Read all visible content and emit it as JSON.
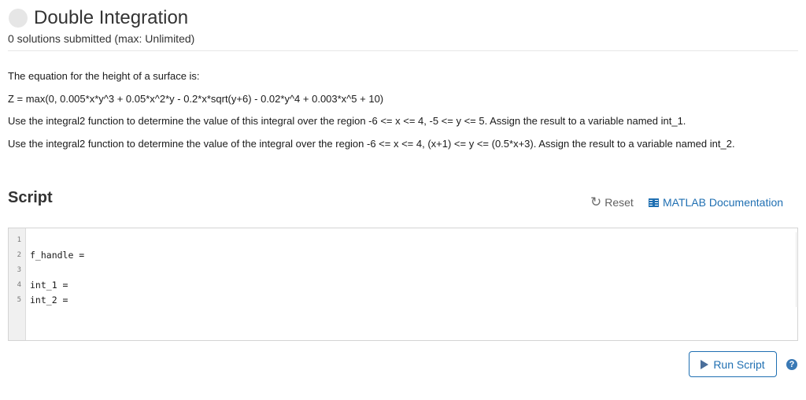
{
  "header": {
    "title": "Double Integration",
    "subtitle": "0 solutions submitted (max: Unlimited)"
  },
  "description": {
    "paragraphs": [
      "The equation for the height of a surface is:",
      "Z = max(0, 0.005*x*y^3 + 0.05*x^2*y - 0.2*x*sqrt(y+6) - 0.02*y^4 + 0.003*x^5 + 10)",
      "Use the integral2 function to determine the value of this integral over the region -6 <= x <= 4, -5 <= y <= 5. Assign the result to a variable named int_1.",
      "Use the integral2 function to determine the value of the integral over the region  -6 <= x <= 4, (x+1) <= y <= (0.5*x+3). Assign the result to a variable named int_2."
    ]
  },
  "script": {
    "heading": "Script",
    "reset_label": "Reset",
    "doc_label": "MATLAB Documentation",
    "lines": [
      {
        "num": "1",
        "code": ""
      },
      {
        "num": "2",
        "code": "f_handle ="
      },
      {
        "num": "3",
        "code": ""
      },
      {
        "num": "4",
        "code": "int_1 ="
      },
      {
        "num": "5",
        "code": "int_2 ="
      }
    ],
    "run_label": "Run Script",
    "help_glyph": "?"
  },
  "icons": {
    "status": "status-circle-icon",
    "reset": "refresh-icon",
    "doc": "book-icon",
    "run": "play-icon",
    "help": "question-circle-icon"
  },
  "colors": {
    "accent": "#1f6fb2",
    "status_circle": "#e6e6e6"
  }
}
